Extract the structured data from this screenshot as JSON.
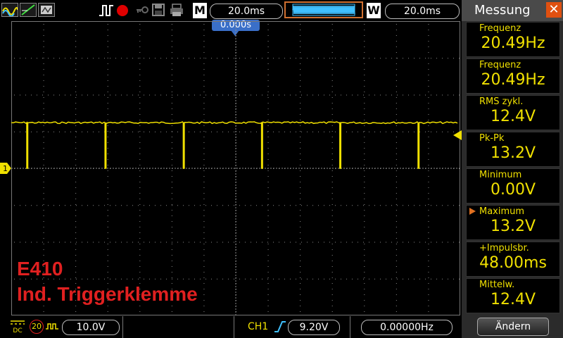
{
  "toolbar": {
    "mode_label": "M",
    "timebase": "20.0ms",
    "window_label": "W",
    "window_timebase": "20.0ms",
    "trigger_position": "0.000s"
  },
  "overlay": {
    "line1": "E410",
    "line2": "Ind. Triggerklemme"
  },
  "bottom": {
    "coupling": "DC",
    "bandwidth": "20",
    "ch1_scale": "10.0V",
    "trigger_channel": "CH1",
    "trigger_level": "9.20V",
    "frequency": "0.00000Hz",
    "channel_number": "1"
  },
  "panel": {
    "title": "Messung",
    "change_button": "Ändern",
    "measurements": [
      {
        "label": "Frequenz",
        "value": "20.49Hz"
      },
      {
        "label": "Frequenz",
        "value": "20.49Hz"
      },
      {
        "label": "RMS  zykl.",
        "value": "12.4V"
      },
      {
        "label": "Pk-Pk",
        "value": "13.2V"
      },
      {
        "label": "Minimum",
        "value": "0.00V"
      },
      {
        "label": "Maximum",
        "value": "13.2V"
      },
      {
        "label": "+Impulsbr.",
        "value": "48.00ms"
      },
      {
        "label": "Mittelw.",
        "value": "12.4V"
      }
    ]
  },
  "colors": {
    "trace": "#f0e000",
    "accent": "#3a6fc8",
    "overlay_text": "#e02020",
    "close": "#e05010"
  },
  "waveform": {
    "high_level_v": 12.4,
    "low_level_v": 0.0,
    "period_ms": 48.8,
    "volts_per_div": 10.0,
    "time_per_div_ms": 20.0
  }
}
